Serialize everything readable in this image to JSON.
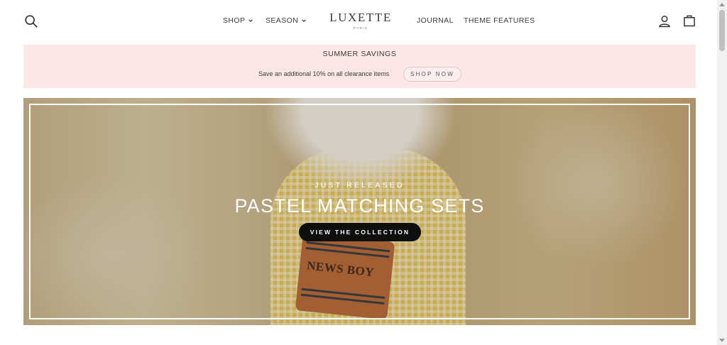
{
  "header": {
    "nav_left": [
      {
        "label": "SHOP",
        "has_dropdown": true
      },
      {
        "label": "SEASON",
        "has_dropdown": true
      }
    ],
    "logo": {
      "name": "LUXETTE",
      "subtitle": "PARIS"
    },
    "nav_right": [
      {
        "label": "JOURNAL"
      },
      {
        "label": "THEME FEATURES"
      }
    ],
    "icons": {
      "search": "search-icon",
      "account": "user-icon",
      "cart": "bag-icon"
    }
  },
  "promo": {
    "title": "SUMMER SAVINGS",
    "text": "Save an additional 10% on all clearance items",
    "button_label": "SHOP NOW",
    "background_color": "#fce6e6"
  },
  "hero": {
    "eyebrow": "JUST RELEASED",
    "title": "PASTEL MATCHING SETS",
    "cta_label": "VIEW THE COLLECTION",
    "image_text": "NEWS BOY"
  }
}
